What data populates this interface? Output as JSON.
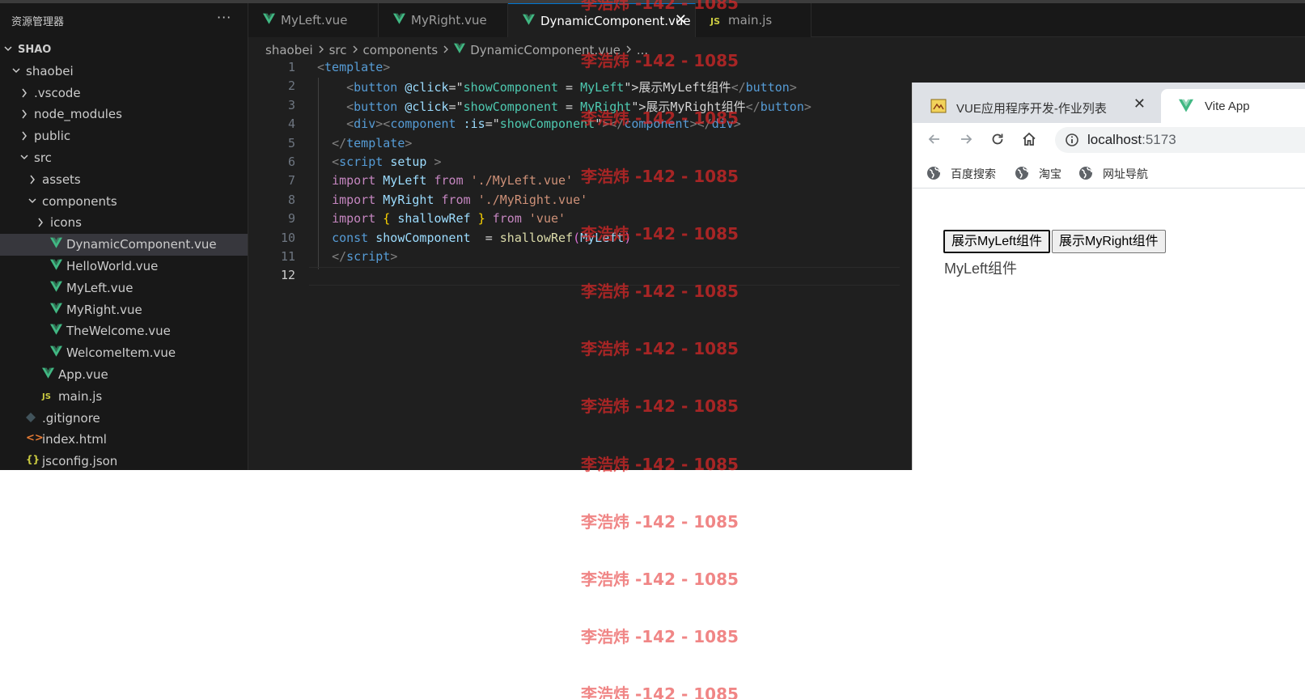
{
  "explorer": {
    "title": "资源管理器",
    "more": "···",
    "tree": [
      {
        "label": "SHAO",
        "chevron": "down",
        "icon": "",
        "root": true
      },
      {
        "label": "shaobei",
        "chevron": "down",
        "icon": ""
      },
      {
        "label": ".vscode",
        "chevron": "right",
        "icon": ""
      },
      {
        "label": "node_modules",
        "chevron": "right",
        "icon": ""
      },
      {
        "label": "public",
        "chevron": "right",
        "icon": ""
      },
      {
        "label": "src",
        "chevron": "down",
        "icon": ""
      },
      {
        "label": "assets",
        "chevron": "right",
        "icon": ""
      },
      {
        "label": "components",
        "chevron": "down",
        "icon": ""
      },
      {
        "label": "icons",
        "chevron": "right",
        "icon": ""
      },
      {
        "label": "DynamicComponent.vue",
        "chevron": "",
        "icon": "vue",
        "selected": true
      },
      {
        "label": "HelloWorld.vue",
        "chevron": "",
        "icon": "vue"
      },
      {
        "label": "MyLeft.vue",
        "chevron": "",
        "icon": "vue"
      },
      {
        "label": "MyRight.vue",
        "chevron": "",
        "icon": "vue"
      },
      {
        "label": "TheWelcome.vue",
        "chevron": "",
        "icon": "vue"
      },
      {
        "label": "WelcomeItem.vue",
        "chevron": "",
        "icon": "vue"
      },
      {
        "label": "App.vue",
        "chevron": "",
        "icon": "vue"
      },
      {
        "label": "main.js",
        "chevron": "",
        "icon": "js"
      },
      {
        "label": ".gitignore",
        "chevron": "",
        "icon": "git"
      },
      {
        "label": "index.html",
        "chevron": "",
        "icon": "html"
      },
      {
        "label": "jsconfig.json",
        "chevron": "",
        "icon": "json"
      }
    ]
  },
  "tabs": [
    {
      "label": "MyLeft.vue",
      "icon": "vue",
      "active": false
    },
    {
      "label": "MyRight.vue",
      "icon": "vue",
      "active": false
    },
    {
      "label": "DynamicComponent.vue",
      "icon": "vue",
      "active": true,
      "close": "✕"
    },
    {
      "label": "main.js",
      "icon": "js",
      "active": false
    }
  ],
  "icon_text": {
    "js": "JS",
    "json": "{}"
  },
  "breadcrumb": [
    "shaobei",
    "src",
    "components",
    "DynamicComponent.vue",
    "..."
  ],
  "editor": {
    "line_numbers": [
      "1",
      "2",
      "3",
      "4",
      "5",
      "6",
      "7",
      "8",
      "9",
      "10",
      "11",
      "12"
    ],
    "current_line": "12",
    "lines": [
      [
        [
          "t-br",
          "<"
        ],
        [
          "t-tag",
          "template"
        ],
        [
          "t-br",
          ">"
        ]
      ],
      [
        [
          "t-txt",
          "    "
        ],
        [
          "t-br",
          "<"
        ],
        [
          "t-tag",
          "button"
        ],
        [
          "t-txt",
          " "
        ],
        [
          "t-attr",
          "@click"
        ],
        [
          "t-txt",
          "=\""
        ],
        [
          "t-comp",
          "showComponent"
        ],
        [
          "t-txt",
          " = "
        ],
        [
          "t-comp",
          "MyLeft"
        ],
        [
          "t-txt",
          "\">展示MyLeft组件"
        ],
        [
          "t-br",
          "</"
        ],
        [
          "t-tag",
          "button"
        ],
        [
          "t-br",
          ">"
        ]
      ],
      [
        [
          "t-txt",
          "    "
        ],
        [
          "t-br",
          "<"
        ],
        [
          "t-tag",
          "button"
        ],
        [
          "t-txt",
          " "
        ],
        [
          "t-attr",
          "@click"
        ],
        [
          "t-txt",
          "=\""
        ],
        [
          "t-comp",
          "showComponent"
        ],
        [
          "t-txt",
          " = "
        ],
        [
          "t-comp",
          "MyRight"
        ],
        [
          "t-txt",
          "\">展示MyRight组件"
        ],
        [
          "t-br",
          "</"
        ],
        [
          "t-tag",
          "button"
        ],
        [
          "t-br",
          ">"
        ]
      ],
      [
        [
          "t-txt",
          "    "
        ],
        [
          "t-br",
          "<"
        ],
        [
          "t-tag",
          "div"
        ],
        [
          "t-br",
          "><"
        ],
        [
          "t-tag",
          "component"
        ],
        [
          "t-txt",
          " "
        ],
        [
          "t-attr",
          ":is"
        ],
        [
          "t-txt",
          "=\""
        ],
        [
          "t-comp",
          "showComponent"
        ],
        [
          "t-txt",
          "\""
        ],
        [
          "t-br",
          "></"
        ],
        [
          "t-tag",
          "component"
        ],
        [
          "t-br",
          "></"
        ],
        [
          "t-tag",
          "div"
        ],
        [
          "t-br",
          ">"
        ]
      ],
      [
        [
          "t-txt",
          "  "
        ],
        [
          "t-br",
          "</"
        ],
        [
          "t-tag",
          "template"
        ],
        [
          "t-br",
          ">"
        ]
      ],
      [
        [
          "t-txt",
          "  "
        ],
        [
          "t-br",
          "<"
        ],
        [
          "t-tag",
          "script"
        ],
        [
          "t-txt",
          " "
        ],
        [
          "t-attr",
          "setup"
        ],
        [
          "t-txt",
          " "
        ],
        [
          "t-br",
          ">"
        ]
      ],
      [
        [
          "t-txt",
          "  "
        ],
        [
          "t-kw",
          "import"
        ],
        [
          "t-txt",
          " "
        ],
        [
          "t-var",
          "MyLeft"
        ],
        [
          "t-txt",
          " "
        ],
        [
          "t-kw",
          "from"
        ],
        [
          "t-txt",
          " "
        ],
        [
          "t-str",
          "'./MyLeft.vue'"
        ]
      ],
      [
        [
          "t-txt",
          "  "
        ],
        [
          "t-kw",
          "import"
        ],
        [
          "t-txt",
          " "
        ],
        [
          "t-var",
          "MyRight"
        ],
        [
          "t-txt",
          " "
        ],
        [
          "t-kw",
          "from"
        ],
        [
          "t-txt",
          " "
        ],
        [
          "t-str",
          "'./MyRight.vue'"
        ]
      ],
      [
        [
          "t-txt",
          "  "
        ],
        [
          "t-kw",
          "import"
        ],
        [
          "t-txt",
          " "
        ],
        [
          "t-y",
          "{"
        ],
        [
          "t-txt",
          " "
        ],
        [
          "t-var",
          "shallowRef"
        ],
        [
          "t-txt",
          " "
        ],
        [
          "t-y",
          "}"
        ],
        [
          "t-txt",
          " "
        ],
        [
          "t-kw",
          "from"
        ],
        [
          "t-txt",
          " "
        ],
        [
          "t-str",
          "'vue'"
        ]
      ],
      [
        [
          "t-txt",
          "  "
        ],
        [
          "t-kw2",
          "const"
        ],
        [
          "t-txt",
          " "
        ],
        [
          "t-var",
          "showComponent"
        ],
        [
          "t-txt",
          "  = "
        ],
        [
          "t-fn",
          "shallowRef"
        ],
        [
          "t-pu",
          "("
        ],
        [
          "t-var",
          "MyLeft"
        ],
        [
          "t-pu",
          ")"
        ]
      ],
      [
        [
          "t-txt",
          "  "
        ],
        [
          "t-br",
          "</"
        ],
        [
          "t-tag",
          "script"
        ],
        [
          "t-br",
          ">"
        ]
      ],
      [
        [
          "t-txt",
          ""
        ]
      ]
    ]
  },
  "browser": {
    "tabs": [
      {
        "label": "VUE应用程序开发-作业列表",
        "close": "✕",
        "active": false
      },
      {
        "label": "Vite App",
        "active": true
      }
    ],
    "address": {
      "host": "localhost",
      "port": ":5173"
    },
    "bookmarks": [
      "百度搜索",
      "淘宝",
      "网址导航"
    ],
    "page": {
      "buttons": [
        "展示MyLeft组件",
        "展示MyRight组件"
      ],
      "text": "MyLeft组件"
    }
  },
  "watermark": {
    "text": "李浩炜 -142 - 1085",
    "count": 13
  },
  "colors": {
    "vue_green": "#41b883",
    "vue_dark": "#35495e",
    "watermark_red": "#dc2828"
  }
}
